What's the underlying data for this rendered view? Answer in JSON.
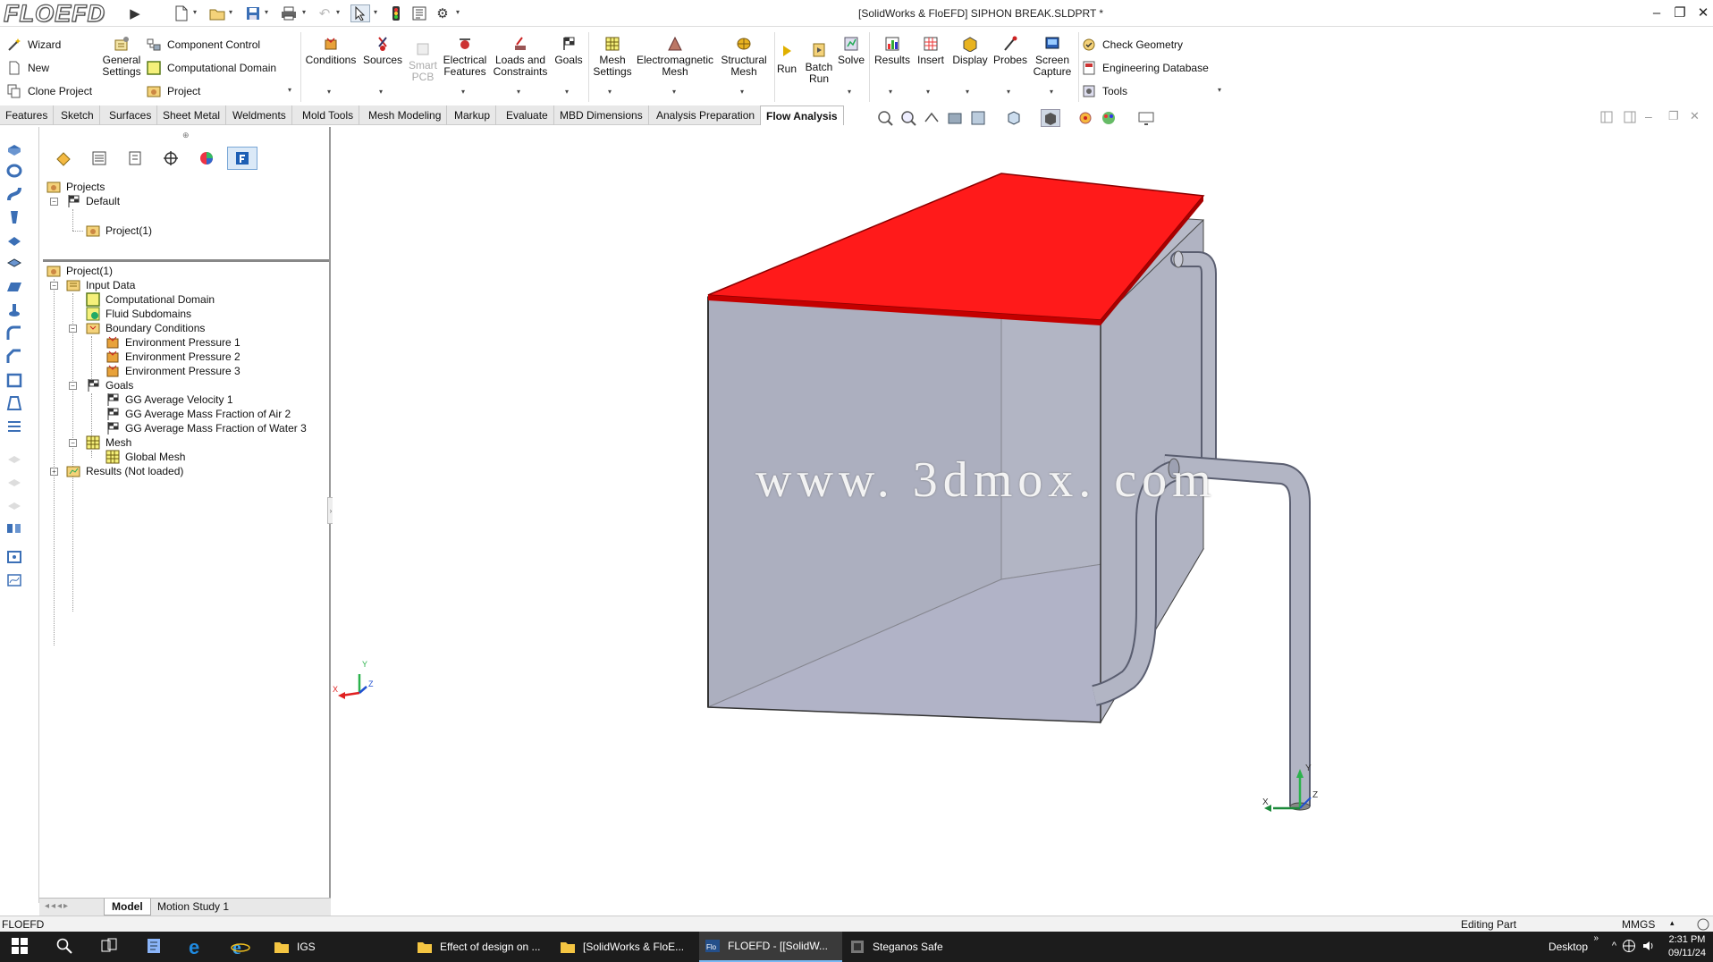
{
  "app": {
    "logo_text": "FLOEFD",
    "window_title": "[SolidWorks & FloEFD] SIPHON BREAK.SLDPRT *"
  },
  "window_controls": {
    "minimize": "–",
    "restore": "❐",
    "close": "✕"
  },
  "ribbon": {
    "left_group": [
      {
        "label": "Wizard",
        "icon": "wand-icon"
      },
      {
        "label": "New",
        "icon": "new-document-icon"
      },
      {
        "label": "Clone Project",
        "icon": "clone-project-icon"
      }
    ],
    "general_settings": "General\nSettings",
    "middle_group": [
      {
        "label": "Component Control",
        "icon": "component-control-icon"
      },
      {
        "label": "Computational Domain",
        "icon": "computational-domain-icon"
      },
      {
        "label": "Project",
        "icon": "project-icon"
      }
    ],
    "buttons": [
      {
        "label": "Conditions",
        "icon": "conditions-icon"
      },
      {
        "label": "Sources",
        "icon": "sources-icon"
      },
      {
        "label": "Smart\nPCB",
        "icon": "smart-pcb-icon",
        "disabled": true
      },
      {
        "label": "Electrical\nFeatures",
        "icon": "electrical-features-icon"
      },
      {
        "label": "Loads and\nConstraints",
        "icon": "loads-constraints-icon"
      },
      {
        "label": "Goals",
        "icon": "goals-icon"
      },
      {
        "label": "Mesh\nSettings",
        "icon": "mesh-settings-icon"
      },
      {
        "label": "Electromagnetic\nMesh",
        "icon": "electromagnetic-mesh-icon"
      },
      {
        "label": "Structural\nMesh",
        "icon": "structural-mesh-icon"
      },
      {
        "label": "Run",
        "icon": "run-icon"
      },
      {
        "label": "Batch\nRun",
        "icon": "batch-run-icon"
      },
      {
        "label": "Solve",
        "icon": "solve-icon"
      },
      {
        "label": "Results",
        "icon": "results-icon"
      },
      {
        "label": "Insert",
        "icon": "insert-icon"
      },
      {
        "label": "Display",
        "icon": "display-icon"
      },
      {
        "label": "Probes",
        "icon": "probes-icon"
      },
      {
        "label": "Screen\nCapture",
        "icon": "screen-capture-icon"
      }
    ],
    "right_group": [
      {
        "label": "Check Geometry",
        "icon": "check-geometry-icon"
      },
      {
        "label": "Engineering Database",
        "icon": "engineering-database-icon"
      },
      {
        "label": "Tools",
        "icon": "tools-icon"
      }
    ]
  },
  "tabs": [
    "Features",
    "Sketch",
    "Surfaces",
    "Sheet Metal",
    "Weldments",
    "Mold Tools",
    "Mesh Modeling",
    "Markup",
    "Evaluate",
    "MBD Dimensions",
    "Analysis Preparation",
    "Flow Analysis"
  ],
  "active_tab": "Flow Analysis",
  "projects_tree": {
    "root": "Projects",
    "child": "Default",
    "grandchild": "Project(1)"
  },
  "analysis_tree": {
    "root": "Project(1)",
    "input_data": "Input Data",
    "computational_domain": "Computational Domain",
    "fluid_subdomains": "Fluid Subdomains",
    "boundary_conditions": "Boundary Conditions",
    "bc_items": [
      "Environment Pressure 1",
      "Environment Pressure 2",
      "Environment Pressure 3"
    ],
    "goals": "Goals",
    "goal_items": [
      "GG Average Velocity 1",
      "GG Average Mass Fraction of Air 2",
      "GG Average Mass Fraction of Water 3"
    ],
    "mesh": "Mesh",
    "global_mesh": "Global Mesh",
    "results": "Results (Not loaded)"
  },
  "viewport": {
    "watermark": "www. 3dmox. com",
    "triad_labels": {
      "x": "X",
      "y": "Y",
      "z": "Z"
    },
    "lid_color": "#ff1a1a",
    "tank_color": "#b9bcc8",
    "pipe_color": "#a7abbb"
  },
  "bottom_tabs": [
    "Model",
    "Motion Study 1"
  ],
  "status": {
    "left": "FLOEFD",
    "mode": "Editing Part",
    "units": "MMGS"
  },
  "taskbar": {
    "apps": [
      {
        "label": "IGS",
        "icon": "folder-icon"
      },
      {
        "label": "Effect of design on ...",
        "icon": "folder-icon"
      },
      {
        "label": "[SolidWorks & FloE...",
        "icon": "folder-icon"
      },
      {
        "label": "FLOEFD - [[SolidW...",
        "icon": "floefd-icon",
        "active": true
      },
      {
        "label": "Steganos Safe",
        "icon": "steganos-icon"
      }
    ],
    "desktop": "Desktop",
    "time": "2:31 PM",
    "date": "09/11/24"
  }
}
